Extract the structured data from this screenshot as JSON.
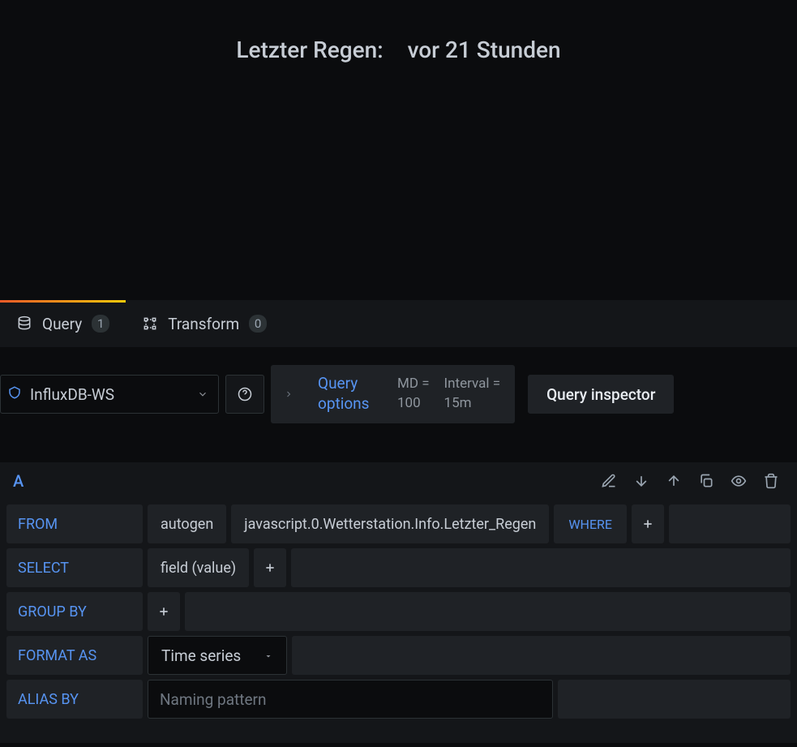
{
  "panel": {
    "title": "Letzter Regen:",
    "value": "vor 21 Stunden"
  },
  "tabs": {
    "query": {
      "label": "Query",
      "count": "1"
    },
    "transform": {
      "label": "Transform",
      "count": "0"
    }
  },
  "datasource": {
    "name": "InfluxDB-WS"
  },
  "query_options": {
    "label": "Query options",
    "md_label": "MD =",
    "md_value": "100",
    "interval_label": "Interval =",
    "interval_value": "15m"
  },
  "inspector_button": "Query inspector",
  "query": {
    "letter": "A",
    "from": {
      "label": "FROM",
      "policy": "autogen",
      "measurement": "javascript.0.Wetterstation.Info.Letzter_Regen",
      "where": "WHERE"
    },
    "select": {
      "label": "SELECT",
      "field": "field (value)"
    },
    "group_by": {
      "label": "GROUP BY"
    },
    "format_as": {
      "label": "FORMAT AS",
      "value": "Time series"
    },
    "alias_by": {
      "label": "ALIAS BY",
      "placeholder": "Naming pattern"
    }
  }
}
